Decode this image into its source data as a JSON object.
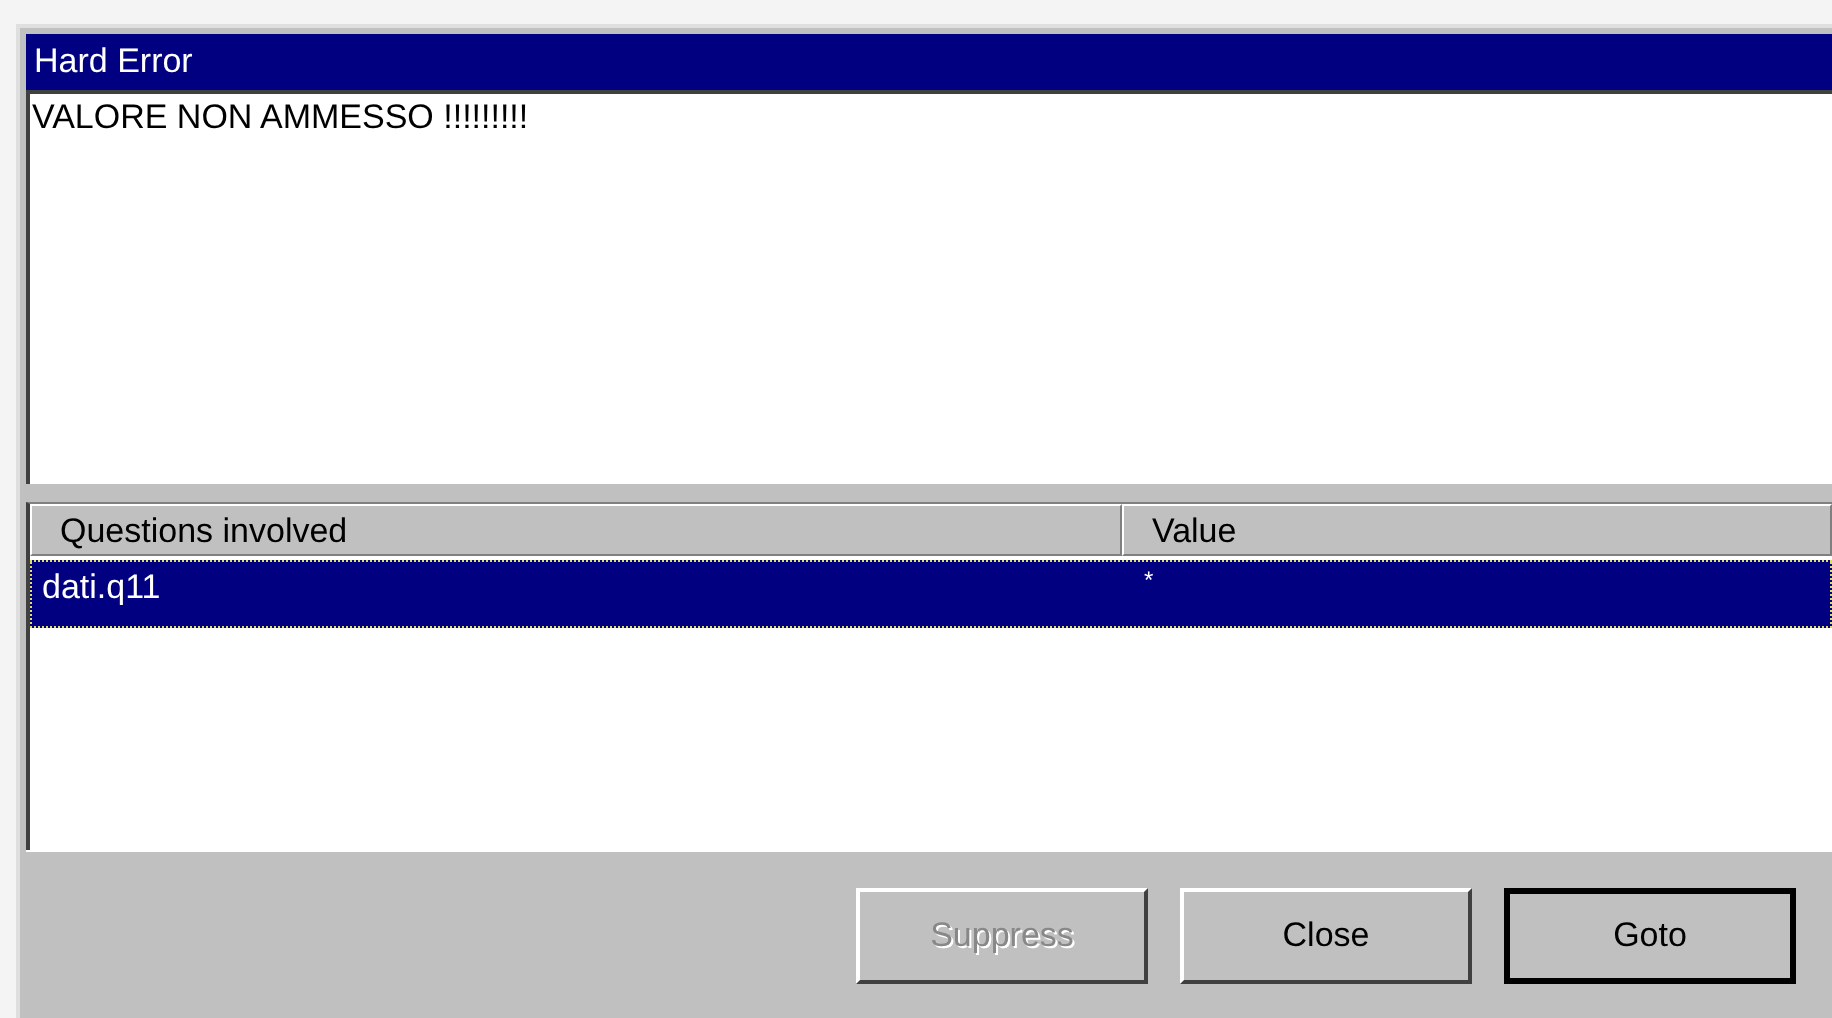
{
  "window": {
    "title": "Hard Error"
  },
  "message": "VALORE NON AMMESSO !!!!!!!!!",
  "table": {
    "columns": [
      "Questions involved",
      "Value"
    ],
    "rows": [
      {
        "cells": [
          "dati.q11",
          "*"
        ],
        "selected": true
      }
    ]
  },
  "buttons": [
    {
      "label": "Suppress",
      "disabled": true,
      "default": false
    },
    {
      "label": "Close",
      "disabled": false,
      "default": false
    },
    {
      "label": "Goto",
      "disabled": false,
      "default": true
    }
  ]
}
